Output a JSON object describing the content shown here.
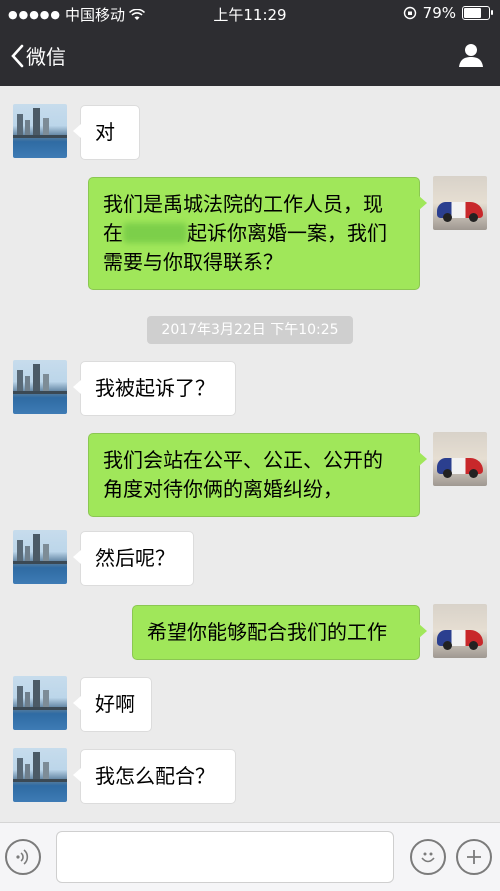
{
  "status_bar": {
    "carrier": "中国移动",
    "time": "上午11:29",
    "battery": "79%",
    "battery_level": 0.79
  },
  "nav": {
    "back_label": "微信",
    "title": ""
  },
  "messages": [
    {
      "side": "in",
      "text": "对"
    },
    {
      "side": "out",
      "text_before_blur": "我们是禹城法院的工作人员，现\n在",
      "text_after_blur": "起诉你离婚一案，我们\n需要与你取得联系？"
    },
    {
      "side": "timestamp",
      "text": "2017年3月22日 下午10:25"
    },
    {
      "side": "in",
      "text": "我被起诉了？"
    },
    {
      "side": "out",
      "text": "我们会站在公平、公正、公开的\n角度对待你俩的离婚纠纷，"
    },
    {
      "side": "in",
      "text": "然后呢？"
    },
    {
      "side": "out",
      "text": "希望你能够配合我们的工作"
    },
    {
      "side": "in",
      "text": "好啊"
    },
    {
      "side": "in",
      "text": "我怎么配合？"
    }
  ],
  "input": {
    "placeholder": "",
    "voice_icon": "voice-icon",
    "emoji_icon": "emoji-icon",
    "plus_icon": "plus-icon"
  },
  "colors": {
    "out_bubble": "#a0e75a",
    "in_bubble": "#ffffff",
    "nav_bg": "#2d2d31",
    "chat_bg": "#ebebeb"
  }
}
